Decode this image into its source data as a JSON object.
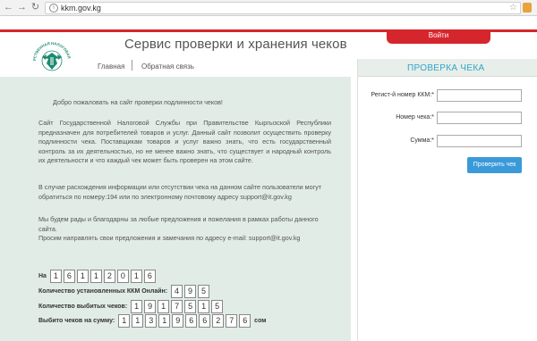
{
  "browser": {
    "url": "kkm.gov.kg",
    "back_icon": "arrow-left-icon",
    "forward_icon": "arrow-right-icon",
    "reload_icon": "reload-icon"
  },
  "header": {
    "login_label": "Войти",
    "title": "Сервис проверки и хранения чеков",
    "logo_text": "ГОСУДАРСТВЕННАЯ НАЛОГОВАЯ СЛУЖБА",
    "nav": {
      "home": "Главная",
      "feedback": "Обратная связь"
    }
  },
  "main": {
    "welcome": "Добро пожаловать на сайт проверки подлинности чеков!",
    "intro": "Сайт Государственной Налоговой Службы при Правительстве Кыргызской Республики предназначен для потребителей товаров и услуг. Данный сайт позволит осуществить проверку подлинности чека. Поставщикам товаров и услуг важно знать, что есть государственный контроль за их деятельностью, но не менее важно знать, что существует и народный контроль их деятельности и что каждый чек может быть проверен на этом сайте.",
    "contact": "В случае расхождения информации или отсутствии чека на данном сайте пользователи могут обратиться по номеру:194 или по электронному почтовому адресу support@it.gov.kg",
    "feedback_line1": "Мы будем рады и благодарны за любые предложения и пожелания в рамках работы данного сайта.",
    "feedback_line2": "Просим направлять свои предложения и замечания по адресу e-mail: support@it.gov.kg"
  },
  "stats": {
    "date_label": "На",
    "date_digits": [
      "1",
      "6",
      "1",
      "1",
      "2",
      "0",
      "1",
      "6"
    ],
    "kkm_label": "Количество установленных ККМ Онлайн:",
    "kkm_digits": [
      "4",
      "9",
      "5"
    ],
    "receipts_label": "Количество выбитых чеков:",
    "receipts_digits": [
      "1",
      "9",
      "1",
      "7",
      "5",
      "1",
      "5"
    ],
    "sum_label": "Выбито чеков на сумму:",
    "sum_digits": [
      "1",
      "1",
      "3",
      "1",
      "9",
      "6",
      "6",
      "2",
      "7",
      "6"
    ],
    "sum_suffix": "сом"
  },
  "check_form": {
    "title": "ПРОВЕРКА ЧЕКА",
    "reg_label": "Регист-й номер ККМ:*",
    "number_label": "Номер чека:*",
    "sum_label": "Сумма:*",
    "reg_value": "",
    "number_value": "",
    "sum_value": "",
    "submit_label": "Проверить чек"
  },
  "colors": {
    "accent_red": "#d6262d",
    "panel_bg": "#e1ece7",
    "title_blue": "#31a6c7",
    "button_blue": "#3a9ad9",
    "logo_green": "#1a8a6f"
  }
}
